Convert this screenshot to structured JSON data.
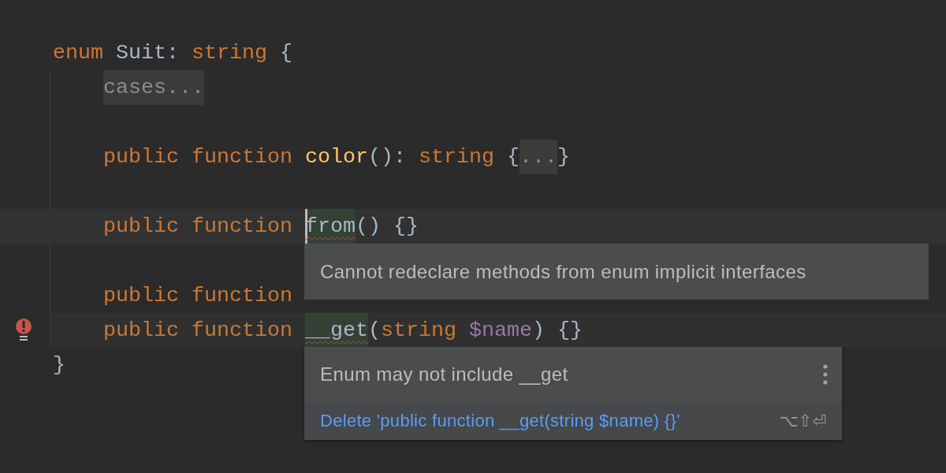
{
  "editor": {
    "lines": [
      {
        "kind": "code",
        "tokens": [
          {
            "kind": "keyword",
            "text": "enum"
          },
          {
            "kind": "plain",
            "text": " Suit: "
          },
          {
            "kind": "keyword",
            "text": "string"
          },
          {
            "kind": "plain",
            "text": " {"
          }
        ],
        "children": [
          {
            "kind": "code",
            "tokens": [
              {
                "kind": "fold",
                "text": "cases..."
              }
            ]
          },
          {
            "kind": "blank"
          },
          {
            "kind": "code",
            "tokens": [
              {
                "kind": "keyword",
                "text": "public function "
              },
              {
                "kind": "function",
                "text": "color"
              },
              {
                "kind": "plain",
                "text": "(): "
              },
              {
                "kind": "keyword",
                "text": "string"
              },
              {
                "kind": "plain",
                "text": " {"
              },
              {
                "kind": "fold",
                "text": "..."
              },
              {
                "kind": "plain",
                "text": "}"
              }
            ]
          },
          {
            "kind": "blank"
          },
          {
            "kind": "code",
            "current_line": true,
            "tokens": [
              {
                "kind": "keyword",
                "text": "public function "
              },
              {
                "kind": "error",
                "text": "from",
                "caret": true
              },
              {
                "kind": "plain",
                "text": "() {}"
              }
            ]
          },
          {
            "kind": "blank"
          },
          {
            "kind": "code",
            "tokens": [
              {
                "kind": "keyword",
                "text": "public function"
              }
            ]
          },
          {
            "kind": "code",
            "error_line": true,
            "error_mark": true,
            "tokens": [
              {
                "kind": "keyword",
                "text": "public function "
              },
              {
                "kind": "error",
                "text": "__get"
              },
              {
                "kind": "plain",
                "text": "("
              },
              {
                "kind": "keyword",
                "text": "string "
              },
              {
                "kind": "variable",
                "text": "$name"
              },
              {
                "kind": "plain",
                "text": ") {}"
              }
            ]
          }
        ]
      },
      {
        "kind": "code",
        "tokens": [
          {
            "kind": "plain",
            "text": "}"
          }
        ]
      }
    ]
  },
  "tooltip": {
    "text": "Cannot redeclare methods from enum implicit interfaces"
  },
  "intention_popup": {
    "message": "Enum may not include __get",
    "actions": [
      {
        "label": "Delete 'public function __get(string $name) {}'",
        "shortcut": "⌥⇧⏎",
        "selected": true
      }
    ]
  }
}
